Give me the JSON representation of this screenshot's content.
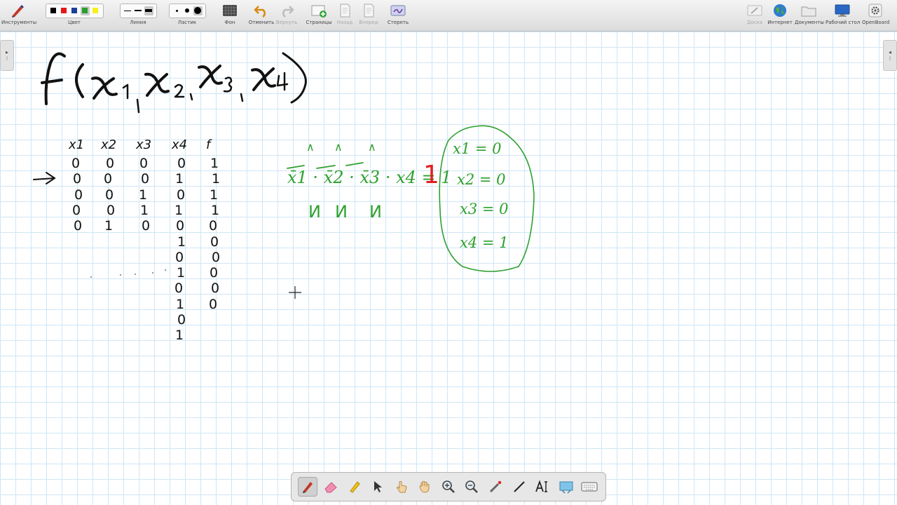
{
  "toolbar": {
    "tools_label": "Инструменты",
    "color_label": "Цвет",
    "line_label": "Линия",
    "eraser_label": "Ластик",
    "background_label": "Фон",
    "undo_label": "Отменить",
    "redo_label": "Вернуть",
    "pages_label": "Страницы",
    "back_label": "Назад",
    "forward_label": "Вперед",
    "erase_label": "Стереть",
    "board_label": "Доска",
    "internet_label": "Интернет",
    "documents_label": "Документы",
    "desktop_label": "Рабочий стол",
    "openboard_label": "OpenBoard",
    "colors": [
      "#000000",
      "#e51818",
      "#1c3f9c",
      "#27a02c",
      "#f5f020"
    ],
    "selected_color": "#27a02c",
    "ink_red": "#e02020"
  },
  "board": {
    "title_expression": "f(x1, x2, x3, x4)",
    "truth_table": {
      "headers": [
        "x1",
        "x2",
        "x3",
        "x4",
        "f"
      ],
      "rows": [
        [
          "0",
          "0",
          "0",
          "0",
          "1"
        ],
        [
          "0",
          "0",
          "0",
          "1",
          "1"
        ],
        [
          "0",
          "0",
          "1",
          "0",
          "1"
        ],
        [
          "0",
          "0",
          "1",
          "1",
          "1"
        ],
        [
          "0",
          "1",
          "0",
          "0",
          "0"
        ],
        [
          "",
          "",
          "",
          "1",
          "0"
        ],
        [
          "",
          "",
          "",
          "0",
          "0"
        ],
        [
          "",
          "",
          "",
          "1",
          "0"
        ],
        [
          "",
          "",
          "",
          "0",
          "0"
        ],
        [
          "",
          "",
          "",
          "1",
          "0"
        ],
        [
          "",
          "",
          "",
          "0",
          ""
        ],
        [
          "",
          "",
          "",
          "1",
          ""
        ]
      ]
    },
    "conjunction": "x̄1 · x̄2 · x̄3 · x4 = 1",
    "conjunction_result": "1",
    "and_marks": [
      "∧",
      "∧",
      "∧"
    ],
    "or_marks": [
      "И",
      "И",
      "И"
    ],
    "assignments": [
      "x1 = 0",
      "x2 = 0",
      "x3 = 0",
      "x4 = 1"
    ]
  },
  "stylus": {
    "tools": [
      "pen",
      "eraser",
      "marker",
      "selector",
      "interactor",
      "hand",
      "zoom-in",
      "zoom-out",
      "laser-pointer",
      "line",
      "text",
      "capture",
      "keyboard"
    ],
    "selected": "pen"
  }
}
